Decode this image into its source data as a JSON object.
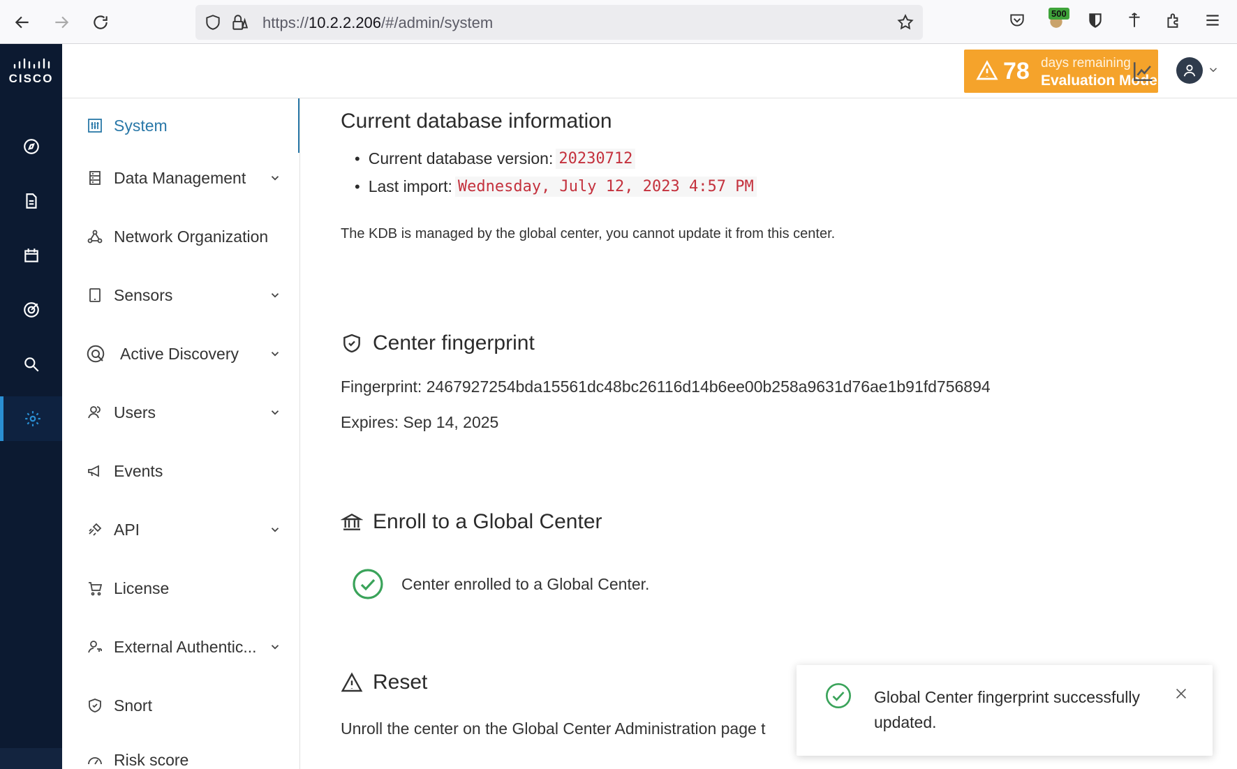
{
  "browser": {
    "url_prefix": "https://",
    "url_host": "10.2.2.206",
    "url_path": "/#/admin/system",
    "ext_badge": "500"
  },
  "rail": {
    "logo_word": "CISCO",
    "items": [
      "compass-icon",
      "document-icon",
      "calendar-icon",
      "target-icon",
      "search-icon",
      "gear-icon"
    ]
  },
  "header": {
    "eval_days": "78",
    "eval_line1": "days remaining",
    "eval_line2": "Evaluation Mode"
  },
  "sidebar": {
    "items": [
      {
        "label": "System"
      },
      {
        "label": "Data Management"
      },
      {
        "label": "Network Organization"
      },
      {
        "label": "Sensors"
      },
      {
        "label": "Active Discovery"
      },
      {
        "label": "Users"
      },
      {
        "label": "Events"
      },
      {
        "label": "API"
      },
      {
        "label": "License"
      },
      {
        "label": "External Authentic..."
      },
      {
        "label": "Snort"
      },
      {
        "label": "Risk score"
      }
    ]
  },
  "main": {
    "db_title": "Current database information",
    "db_version_label": "Current database version:",
    "db_version_value": "20230712",
    "last_import_label": "Last import:",
    "last_import_value": "Wednesday, July 12, 2023 4:57 PM",
    "kdb_note": "The KDB is managed by the global center, you cannot update it from this center.",
    "fp_title": "Center fingerprint",
    "fp_line": "Fingerprint: 2467927254bda15561dc48bc26116d14b6ee00b258a9631d76ae1b91fd756894",
    "fp_expires": "Expires: Sep 14, 2025",
    "enroll_title": "Enroll to a Global Center",
    "enroll_status": "Center enrolled to a Global Center.",
    "reset_title": "Reset",
    "reset_text": "Unroll the center on the Global Center Administration page t"
  },
  "toast": {
    "message": "Global Center fingerprint successfully updated."
  },
  "colors": {
    "rail_bg": "#0c1a31",
    "accent": "#2a78a8",
    "eval_bg": "#f5a32b",
    "success": "#3aa35a",
    "code_red": "#c4313d"
  }
}
